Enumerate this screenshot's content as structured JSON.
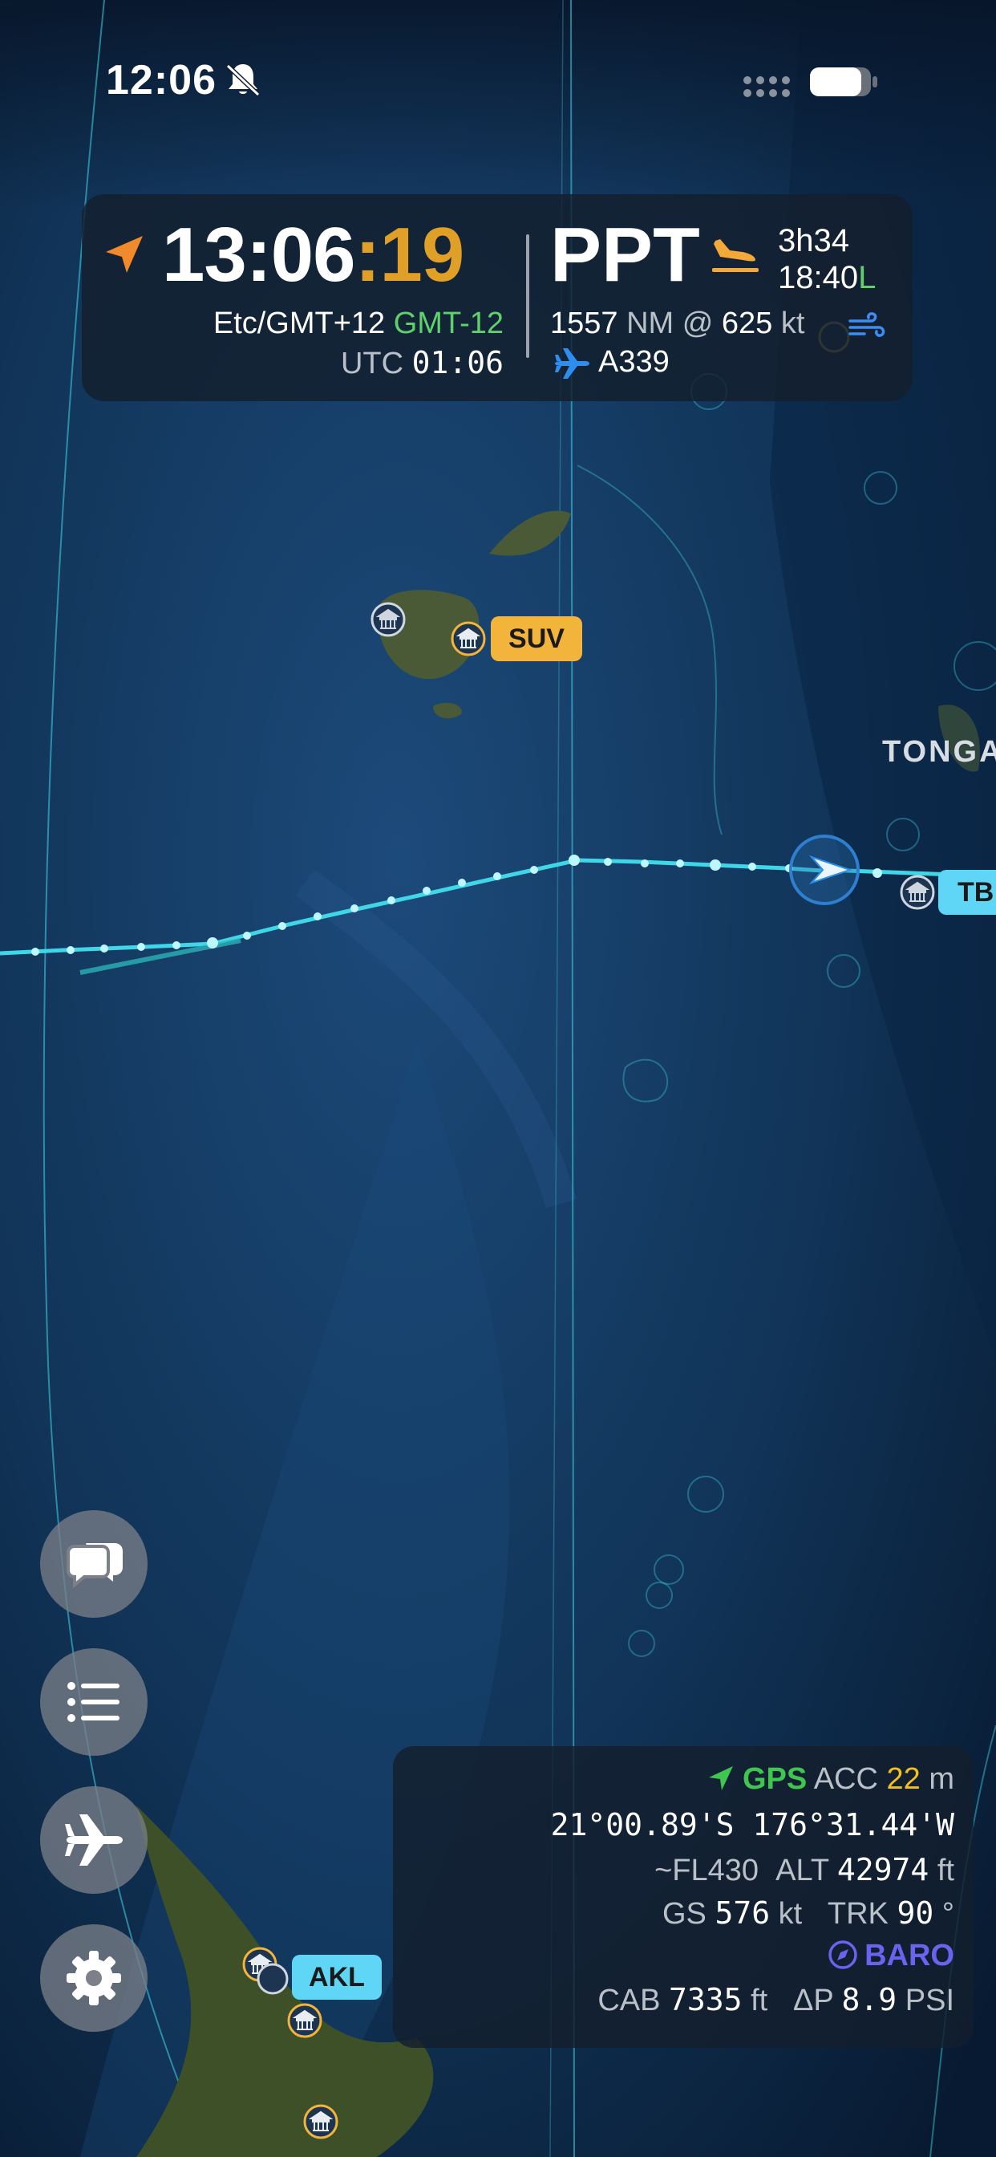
{
  "status_bar": {
    "time": "12:06"
  },
  "top_panel": {
    "local_time_hm": "13:06",
    "local_time_colon": ":",
    "local_time_sec": "19",
    "timezone_name": "Etc/GMT+12",
    "timezone_offset": "GMT-12",
    "utc_label": "UTC",
    "utc_time": "01:06",
    "destination": "PPT",
    "time_remaining": "3h34",
    "eta_time": "18:40",
    "eta_suffix": "L",
    "distance": "1557",
    "distance_unit": "NM @",
    "speed": "625",
    "speed_unit": "kt",
    "aircraft_type": "A339"
  },
  "map": {
    "labels": {
      "suv": "SUV",
      "tbu": "TB",
      "akl": "AKL",
      "country": "TONGA"
    },
    "colors": {
      "route": "#3fd6e8",
      "airport_main": "#f3b43c",
      "airport_alt": "#5fd6f5"
    }
  },
  "fabs": [
    "chat-icon",
    "list-icon",
    "airplane-icon",
    "gear-icon"
  ],
  "position_panel": {
    "gps_label": "GPS",
    "acc_label": "ACC",
    "acc_value": "22",
    "acc_unit": "m",
    "coords": "21°00.89'S 176°31.44'W",
    "fl": "~FL430",
    "alt_label": "ALT",
    "alt_value": "42974",
    "alt_unit": "ft",
    "gs_label": "GS",
    "gs_value": "576",
    "gs_unit": "kt",
    "trk_label": "TRK",
    "trk_value": "90",
    "trk_unit": "°",
    "baro_label": "BARO",
    "cab_label": "CAB",
    "cab_value": "7335",
    "cab_unit": "ft",
    "dp_label": "ΔP",
    "dp_value": "8.9",
    "dp_unit": "PSI"
  }
}
